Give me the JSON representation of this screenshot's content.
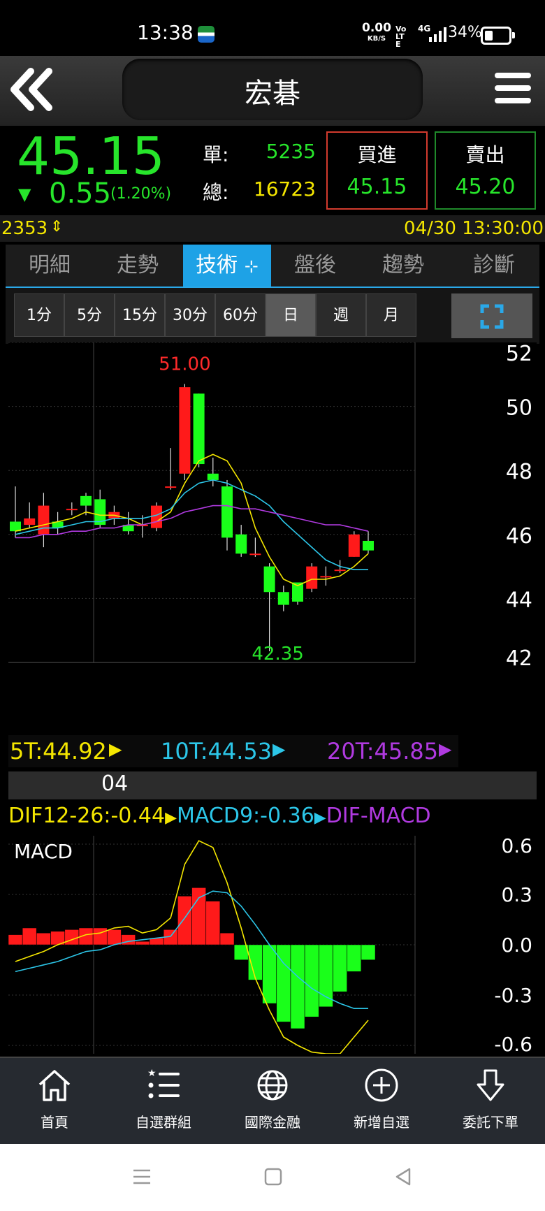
{
  "status_bar": {
    "time": "13:38",
    "net_speed": "0.00",
    "net_unit": "KB/S",
    "volte": "Vo LTE",
    "network": "4G",
    "battery": "34%"
  },
  "header": {
    "title": "宏碁"
  },
  "quote": {
    "price": "45.15",
    "change": "0.55",
    "change_pct": "(1.20%)",
    "single_label": "單:",
    "single_value": "5235",
    "total_label": "總:",
    "total_value": "16723",
    "buy_label": "買進",
    "buy_price": "45.15",
    "sell_label": "賣出",
    "sell_price": "45.20"
  },
  "info": {
    "code": "2353",
    "datetime": "04/30 13:30:00"
  },
  "tabs": [
    "明細",
    "走勢",
    "技術",
    "盤後",
    "趨勢",
    "診斷"
  ],
  "active_tab": "技術",
  "periods": [
    "1分",
    "5分",
    "15分",
    "30分",
    "60分",
    "日",
    "週",
    "月"
  ],
  "active_period": "日",
  "ma_legend": {
    "ma5": "5T:44.92",
    "ma10": "10T:44.53",
    "ma20": "20T:45.85"
  },
  "date_label": "04",
  "macd_legend": {
    "dif": "DIF12-26:-0.44",
    "macd": "MACD9:-0.36",
    "osc": "DIF-MACD"
  },
  "macd_title": "MACD",
  "colors": {
    "up": "#ff1a1a",
    "down": "#1aff1a",
    "ma5": "#f4e600",
    "ma10": "#2cc6e8",
    "ma20": "#b03ae0",
    "accent": "#1ea2e6"
  },
  "chart_data": [
    {
      "type": "candlestick",
      "ylim": [
        42,
        52
      ],
      "yticks": [
        "52",
        "50",
        "48",
        "46",
        "44",
        "42"
      ],
      "high_label": "51.00",
      "low_label": "42.35",
      "candles": [
        {
          "o": 46.4,
          "c": 46.1,
          "h": 47.5,
          "l": 45.9
        },
        {
          "o": 46.3,
          "c": 46.5,
          "h": 47.0,
          "l": 46.2
        },
        {
          "o": 46.0,
          "c": 46.9,
          "h": 47.3,
          "l": 45.6
        },
        {
          "o": 46.4,
          "c": 46.2,
          "h": 46.7,
          "l": 46.0
        },
        {
          "o": 46.8,
          "c": 46.8,
          "h": 47.0,
          "l": 46.6
        },
        {
          "o": 47.2,
          "c": 46.9,
          "h": 47.3,
          "l": 46.6
        },
        {
          "o": 47.1,
          "c": 46.3,
          "h": 47.4,
          "l": 46.2
        },
        {
          "o": 46.5,
          "c": 46.7,
          "h": 46.9,
          "l": 46.3
        },
        {
          "o": 46.3,
          "c": 46.1,
          "h": 46.7,
          "l": 46.0
        },
        {
          "o": 46.3,
          "c": 46.3,
          "h": 46.6,
          "l": 45.9
        },
        {
          "o": 46.2,
          "c": 46.9,
          "h": 47.0,
          "l": 46.1
        },
        {
          "o": 47.5,
          "c": 47.5,
          "h": 48.7,
          "l": 47.4
        },
        {
          "o": 47.9,
          "c": 50.6,
          "h": 50.7,
          "l": 47.7
        },
        {
          "o": 50.4,
          "c": 48.2,
          "h": 50.4,
          "l": 48.1
        },
        {
          "o": 47.9,
          "c": 47.7,
          "h": 48.4,
          "l": 47.5
        },
        {
          "o": 47.5,
          "c": 45.9,
          "h": 47.7,
          "l": 45.5
        },
        {
          "o": 46.0,
          "c": 45.4,
          "h": 46.3,
          "l": 45.3
        },
        {
          "o": 45.4,
          "c": 45.4,
          "h": 45.9,
          "l": 45.3
        },
        {
          "o": 45.0,
          "c": 44.2,
          "h": 45.1,
          "l": 42.35
        },
        {
          "o": 44.2,
          "c": 43.8,
          "h": 44.4,
          "l": 43.6
        },
        {
          "o": 44.5,
          "c": 43.9,
          "h": 44.5,
          "l": 43.8
        },
        {
          "o": 44.3,
          "c": 45.0,
          "h": 45.1,
          "l": 44.2
        },
        {
          "o": 44.7,
          "c": 44.7,
          "h": 45.0,
          "l": 44.4
        },
        {
          "o": 44.9,
          "c": 44.9,
          "h": 45.2,
          "l": 44.8
        },
        {
          "o": 45.3,
          "c": 46.0,
          "h": 46.1,
          "l": 45.3
        },
        {
          "o": 45.8,
          "c": 45.5,
          "h": 46.1,
          "l": 45.4
        }
      ],
      "series": [
        {
          "name": "5T",
          "values": [
            46.1,
            46.2,
            46.3,
            46.4,
            46.5,
            46.7,
            46.6,
            46.6,
            46.5,
            46.3,
            46.4,
            46.7,
            47.6,
            48.3,
            48.5,
            48.3,
            47.6,
            46.2,
            45.3,
            44.6,
            44.4,
            44.6,
            44.6,
            44.7,
            45.0,
            45.4
          ]
        },
        {
          "name": "10T",
          "values": [
            46.0,
            46.1,
            46.2,
            46.2,
            46.3,
            46.4,
            46.4,
            46.5,
            46.5,
            46.5,
            46.6,
            46.8,
            47.3,
            47.6,
            47.7,
            47.6,
            47.4,
            47.2,
            46.9,
            46.4,
            46.0,
            45.6,
            45.2,
            45.0,
            44.9,
            44.9
          ]
        },
        {
          "name": "20T",
          "values": [
            45.9,
            45.9,
            46.0,
            46.0,
            46.1,
            46.1,
            46.2,
            46.2,
            46.3,
            46.3,
            46.4,
            46.5,
            46.7,
            46.8,
            46.9,
            46.9,
            46.8,
            46.8,
            46.7,
            46.6,
            46.5,
            46.4,
            46.3,
            46.3,
            46.2,
            46.1
          ]
        }
      ]
    },
    {
      "type": "bar",
      "title": "MACD",
      "ylim": [
        -0.65,
        0.65
      ],
      "yticks": [
        "0.6",
        "0.3",
        "0.0",
        "-0.3",
        "-0.6"
      ],
      "values": [
        0.06,
        0.1,
        0.07,
        0.08,
        0.09,
        0.1,
        0.1,
        0.09,
        0.06,
        0.02,
        0.04,
        0.09,
        0.29,
        0.34,
        0.26,
        0.07,
        -0.09,
        -0.21,
        -0.35,
        -0.46,
        -0.5,
        -0.43,
        -0.37,
        -0.28,
        -0.16,
        -0.09
      ],
      "series": [
        {
          "name": "DIF12-26",
          "values": [
            -0.1,
            -0.07,
            -0.04,
            0.0,
            0.03,
            0.06,
            0.07,
            0.1,
            0.11,
            0.07,
            0.09,
            0.16,
            0.48,
            0.62,
            0.58,
            0.37,
            0.1,
            -0.2,
            -0.39,
            -0.55,
            -0.6,
            -0.64,
            -0.65,
            -0.65,
            -0.55,
            -0.45
          ]
        },
        {
          "name": "MACD9",
          "values": [
            -0.16,
            -0.14,
            -0.12,
            -0.1,
            -0.07,
            -0.04,
            -0.03,
            0.0,
            0.02,
            0.03,
            0.04,
            0.05,
            0.16,
            0.28,
            0.32,
            0.31,
            0.23,
            0.12,
            0.0,
            -0.11,
            -0.19,
            -0.26,
            -0.31,
            -0.35,
            -0.38,
            -0.38
          ]
        }
      ]
    }
  ]
}
